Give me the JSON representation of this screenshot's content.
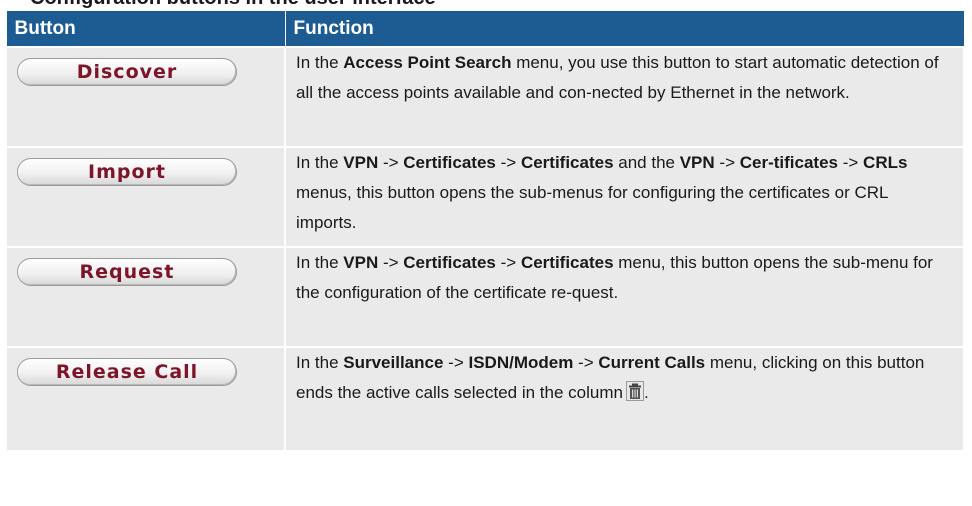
{
  "heading": "Configuration buttons in the user interface",
  "header": {
    "col1": "Button",
    "col2": "Function"
  },
  "rows": [
    {
      "button": "Discover",
      "t1": "In the ",
      "b1": "Access Point Search",
      "t2": " menu, you use this button to start automatic detection of all the access points available and con-nected by Ethernet in the network."
    },
    {
      "button": "Import",
      "t1": "In the ",
      "b1": "VPN",
      "t2": " -> ",
      "b2": "Certificates",
      "t3": " -> ",
      "b3": "Certificates",
      "t4": " and the ",
      "b4": "VPN",
      "t5": " -> ",
      "b5": "Cer-tificates",
      "t6": " -> ",
      "b6": "CRLs",
      "t7": " menus, this button opens the sub-menus for configuring the certificates or CRL imports."
    },
    {
      "button": "Request",
      "t1": "In the ",
      "b1": "VPN",
      "t2": " -> ",
      "b2": "Certificates",
      "t3": " -> ",
      "b3": "Certificates",
      "t4": " menu, this button opens the sub-menu for the configuration of the certificate re-quest."
    },
    {
      "button": "Release Call",
      "t1": "In the ",
      "b1": "Surveillance",
      "t2": " -> ",
      "b2": "ISDN/Modem",
      "t3": " -> ",
      "b3": "Current Calls",
      "t4": " menu, clicking on this button ends the active calls selected in the column",
      "icon": "trash-icon",
      "t5": "."
    }
  ]
}
